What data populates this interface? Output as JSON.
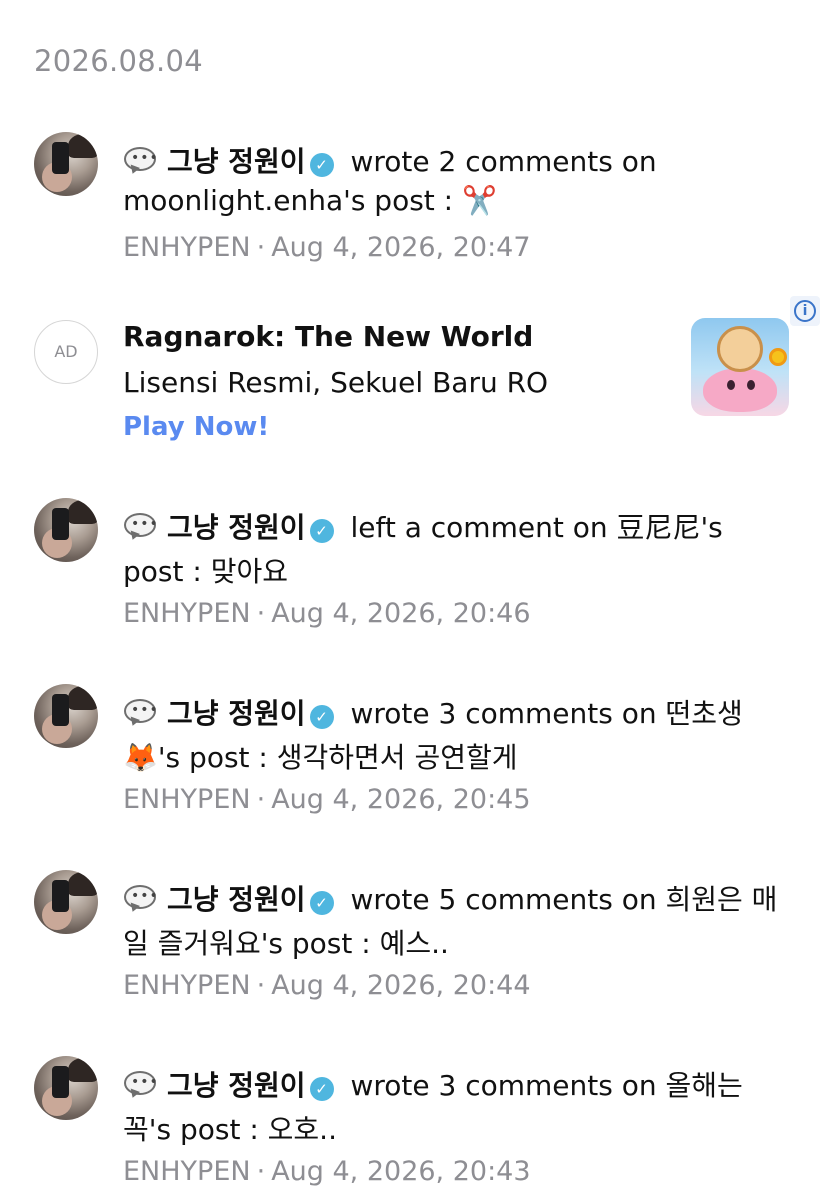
{
  "date_header": "2026.08.04",
  "ad": {
    "badge": "AD",
    "title": "Ragnarok: The New World",
    "subtitle": "Lisensi Resmi, Sekuel Baru RO",
    "cta": "Play Now!",
    "info": "i"
  },
  "items": [
    {
      "user": "그냥 정원이",
      "line1_text": " wrote 2 comments on",
      "line2_text": "moonlight.enha's post : ✂️",
      "group": "ENHYPEN",
      "separator": "·",
      "timestamp": "Aug 4, 2026, 20:47"
    },
    {
      "user": "그냥 정원이",
      "line1_text": " left a comment on 豆尼尼's",
      "line2_text": "post : 맞아요",
      "group": "ENHYPEN",
      "separator": "·",
      "timestamp": "Aug 4, 2026, 20:46"
    },
    {
      "user": "그냥 정원이",
      "line1_text": " wrote 3 comments on 떤초생",
      "line2_text": "🦊's post : 생각하면서 공연할게",
      "group": "ENHYPEN",
      "separator": "·",
      "timestamp": "Aug 4, 2026, 20:45"
    },
    {
      "user": "그냥 정원이",
      "line1_text": " wrote 5 comments on 희원은 매",
      "line2_text": "일 즐거워요's post : 예스..",
      "group": "ENHYPEN",
      "separator": "·",
      "timestamp": "Aug 4, 2026, 20:44"
    },
    {
      "user": "그냥 정원이",
      "line1_text": " wrote 3 comments on 올해는",
      "line2_text": "꼭's post : 오호..",
      "group": "ENHYPEN",
      "separator": "·",
      "timestamp": "Aug 4, 2026, 20:43"
    }
  ],
  "icons": {
    "comment": "speech-bubble-icon",
    "verified": "verified-check-icon",
    "info": "info-icon"
  },
  "colors": {
    "verified": "#4fb6df",
    "cta": "#5a8af0",
    "meta": "#8e8e93"
  }
}
